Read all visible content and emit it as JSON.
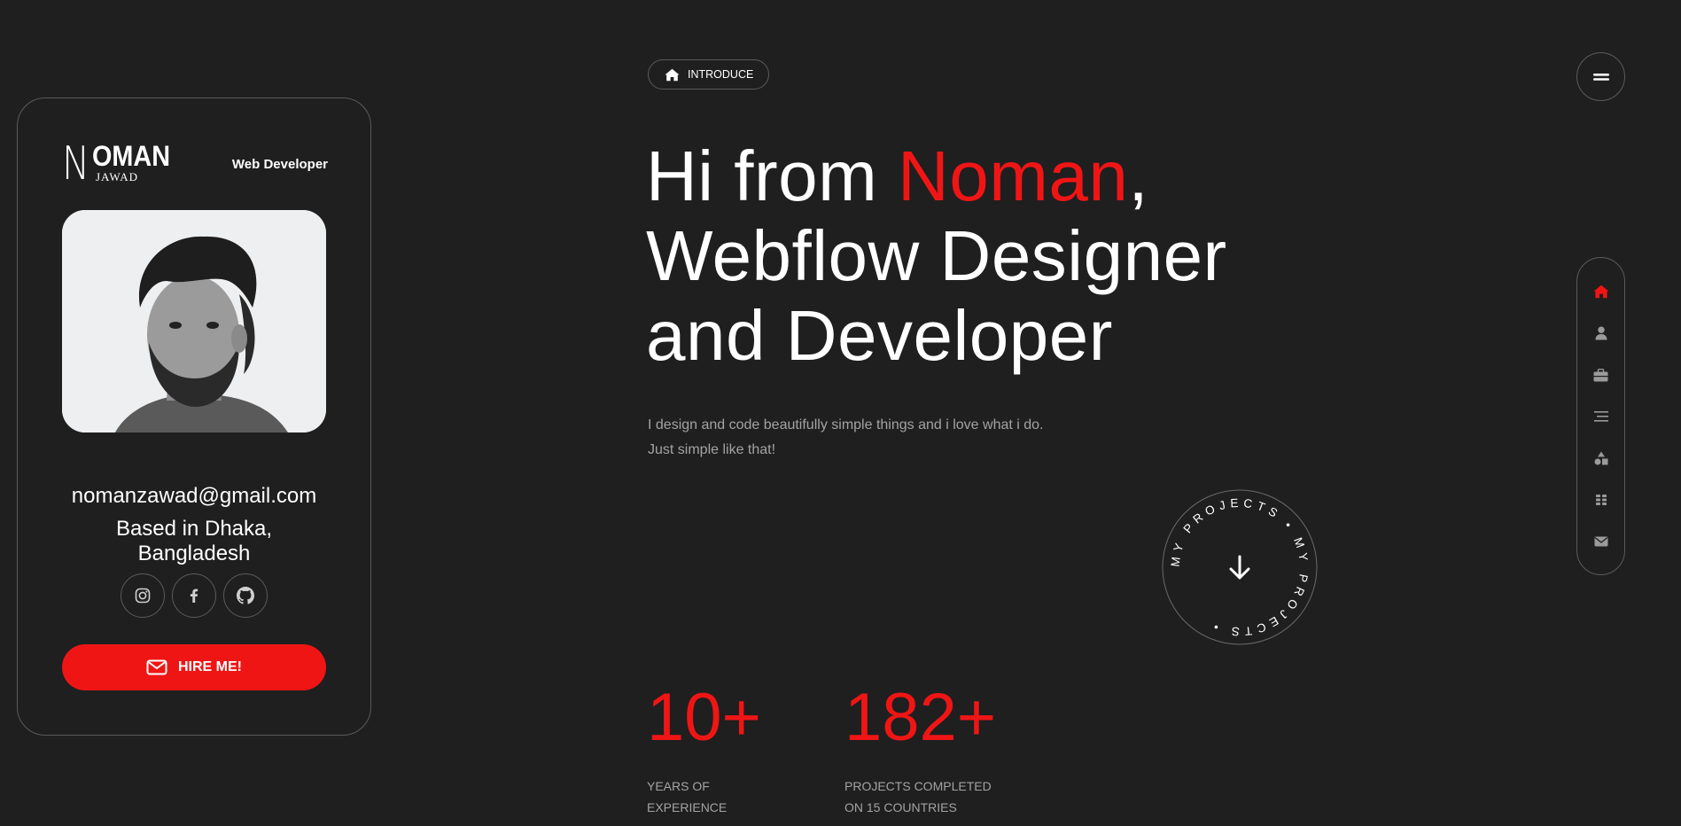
{
  "card": {
    "logo_n": "N",
    "logo_oman": "OMAN",
    "logo_jawad": "JAWAD",
    "role": "Web Developer",
    "email": "nomanzawad@gmail.com",
    "location_line1": "Based in Dhaka,",
    "location_line2": "Bangladesh",
    "hire_label": "HIRE ME!",
    "socials": [
      "instagram-icon",
      "facebook-icon",
      "github-icon"
    ]
  },
  "main": {
    "pill_label": "INTRODUCE",
    "hero_prefix": "Hi from ",
    "hero_name": "Noman",
    "hero_comma": ",",
    "hero_line2": "Webflow Designer",
    "hero_line3": "and Developer",
    "lead_line1": "I design and code beautifully simple things and i love what i do.",
    "lead_line2": "Just simple like that!",
    "circle_text": "MY PROJECTS • MY PROJECTS •",
    "stats": [
      {
        "number": "10+",
        "label_line1": "YEARS OF",
        "label_line2": "EXPERIENCE"
      },
      {
        "number": "182+",
        "label_line1": "PROJECTS COMPLETED",
        "label_line2": "ON 15 COUNTRIES"
      }
    ]
  },
  "nav": {
    "items": [
      "home-icon",
      "user-icon",
      "briefcase-icon",
      "lines-icon",
      "shapes-icon",
      "grid-icon",
      "mail-icon"
    ],
    "active": "home-icon"
  },
  "colors": {
    "background": "#1f1f1f",
    "accent": "#f01515",
    "muted_text": "#a3a3a3",
    "border": "#5b5b5b"
  }
}
